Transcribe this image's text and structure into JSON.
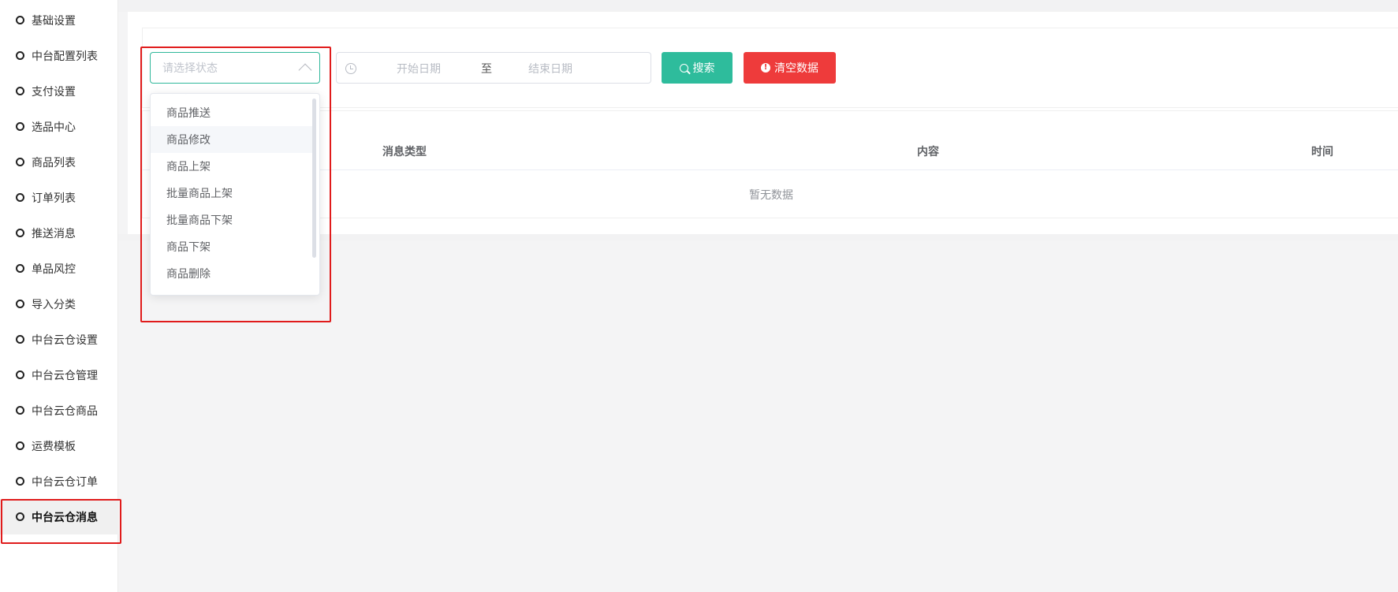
{
  "sidebar": {
    "items": [
      {
        "label": "基础设置"
      },
      {
        "label": "中台配置列表"
      },
      {
        "label": "支付设置"
      },
      {
        "label": "选品中心"
      },
      {
        "label": "商品列表"
      },
      {
        "label": "订单列表"
      },
      {
        "label": "推送消息"
      },
      {
        "label": "单品风控"
      },
      {
        "label": "导入分类"
      },
      {
        "label": "中台云仓设置"
      },
      {
        "label": "中台云仓管理"
      },
      {
        "label": "中台云仓商品"
      },
      {
        "label": "运费模板"
      },
      {
        "label": "中台云仓订单"
      },
      {
        "label": "中台云仓消息"
      }
    ],
    "active_index": 14
  },
  "filters": {
    "status_placeholder": "请选择状态",
    "date_start_placeholder": "开始日期",
    "date_separator": "至",
    "date_end_placeholder": "结束日期",
    "search_label": "搜索",
    "clear_label": "清空数据"
  },
  "dropdown": {
    "options": [
      "商品推送",
      "商品修改",
      "商品上架",
      "批量商品上架",
      "批量商品下架",
      "商品下架",
      "商品删除"
    ],
    "hovered_index": 1
  },
  "table": {
    "columns": [
      "消息类型",
      "内容",
      "时间"
    ],
    "empty_text": "暂无数据"
  },
  "colors": {
    "accent": "#2ebc9c",
    "danger": "#ee3b3b",
    "annotation": "#e01b1b"
  }
}
